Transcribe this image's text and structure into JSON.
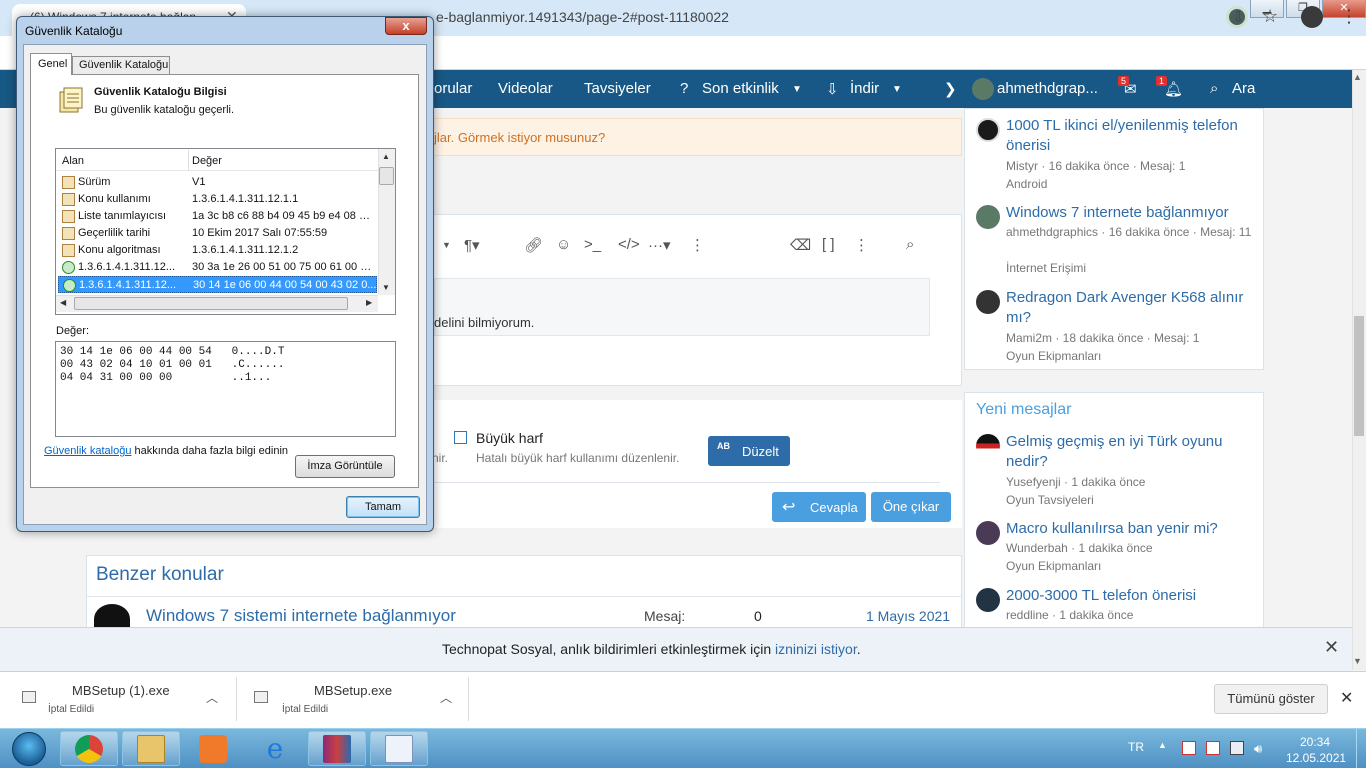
{
  "browser": {
    "tab_title": "(6) Windows 7 internete bağlan",
    "url_fragment": "e-baglanmiyor.1491343/page-2#post-11180022"
  },
  "site_nav": {
    "items": [
      "orular",
      "Videolar",
      "Tavsiyeler",
      "Son etkinlik",
      "İndir"
    ],
    "user": "ahmethdgrap...",
    "inbox_badge": "5",
    "alerts_badge": "1",
    "search": "Ara"
  },
  "notice": {
    "text": "jlar. Görmek istiyor musunuz?"
  },
  "editor": {
    "quote_text": "delini bilmiyorum."
  },
  "spellcheck": {
    "caps_label": "Büyük harf",
    "caps_desc": "Hatalı büyük harf kullanımı düzenlenir.",
    "truncated_desc": "nir.",
    "fix_icon": "AB",
    "fix_label": "Düzelt"
  },
  "actions": {
    "reply": "Cevapla",
    "feature": "Öne çıkar"
  },
  "similar": {
    "title": "Benzer konular",
    "rows": [
      {
        "title": "Windows 7 sistemi internete bağlanmıyor",
        "count_label": "Mesaj:",
        "count": "0",
        "date": "1 Mayıs 2021"
      }
    ]
  },
  "sidebar_top": {
    "threads": [
      {
        "title": "1000 TL ikinci el/yenilenmiş telefon önerisi",
        "meta": "Mistyr · 16 dakika önce · Mesaj: 1",
        "forum": "Android"
      },
      {
        "title": "Windows 7 internete bağlanmıyor",
        "meta": "ahmethdgraphics · 16 dakika önce · Mesaj: 11",
        "forum": "İnternet Erişimi"
      },
      {
        "title": "Redragon Dark Avenger K568 alınır mı?",
        "meta": "Mami2m · 18 dakika önce · Mesaj: 1",
        "forum": "Oyun Ekipmanları"
      }
    ]
  },
  "sidebar_new": {
    "title": "Yeni mesajlar",
    "threads": [
      {
        "title": "Gelmiş geçmiş en iyi Türk oyunu nedir?",
        "meta": "Yusefyenji · 1 dakika önce",
        "forum": "Oyun Tavsiyeleri"
      },
      {
        "title": "Macro kullanılırsa ban yenir mi?",
        "meta": "Wunderbah · 1 dakika önce",
        "forum": "Oyun Ekipmanları"
      },
      {
        "title": "2000-3000 TL telefon önerisi",
        "meta": "reddline · 1 dakika önce"
      }
    ]
  },
  "notification": {
    "text_before": "Technopat Sosyal, anlık bildirimleri etkinleştirmek için ",
    "link": "izninizi istiyor",
    "text_after": "."
  },
  "downloads": {
    "items": [
      {
        "name": "MBSetup (1).exe",
        "status": "İptal Edildi"
      },
      {
        "name": "MBSetup.exe",
        "status": "İptal Edildi"
      }
    ],
    "show_all": "Tümünü göster"
  },
  "taskbar": {
    "lang": "TR",
    "time": "20:34",
    "date": "12.05.2021"
  },
  "dialog": {
    "title": "Güvenlik Kataloğu",
    "close": "x",
    "tabs": [
      "Genel",
      "Güvenlik Kataloğu"
    ],
    "heading": "Güvenlik Kataloğu Bilgisi",
    "subheading": "Bu güvenlik kataloğu geçerli.",
    "columns": [
      "Alan",
      "Değer"
    ],
    "rows": [
      {
        "field": "Sürüm",
        "value": "V1"
      },
      {
        "field": "Konu kullanımı",
        "value": "1.3.6.1.4.1.311.12.1.1"
      },
      {
        "field": "Liste tanımlayıcısı",
        "value": "1a 3c b8 c6 88 b4 09 45 b9 e4 08 6e..."
      },
      {
        "field": "Geçerlilik tarihi",
        "value": "10 Ekim 2017 Salı 07:55:59"
      },
      {
        "field": "Konu algoritması",
        "value": "1.3.6.1.4.1.311.12.1.2"
      },
      {
        "field": "1.3.6.1.4.1.311.12...",
        "value": "30 3a 1e 26 00 51 00 75 00 61 00 6c..."
      },
      {
        "field": "1.3.6.1.4.1.311.12...",
        "value": "30 14 1e 06 00 44 00 54 00 43 02 0..."
      }
    ],
    "value_label": "Değer:",
    "value_text": "30 14 1e 06 00 44 00 54   0....D.T\n00 43 02 04 10 01 00 01   .C......\n04 04 31 00 00 00         ..1...",
    "info_link": "Güvenlik kataloğu",
    "info_text": " hakkında daha fazla bilgi edinin",
    "sig_button": "İmza Görüntüle",
    "ok_button": "Tamam"
  }
}
